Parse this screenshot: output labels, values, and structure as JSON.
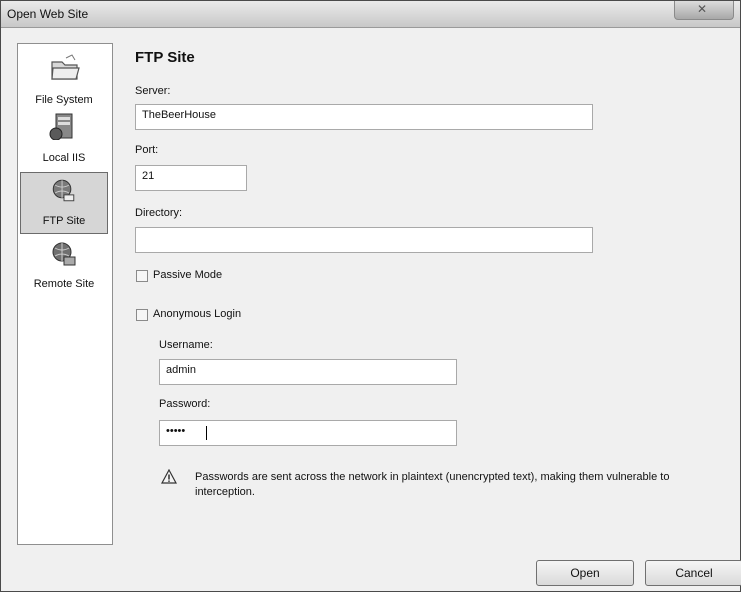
{
  "window": {
    "title": "Open Web Site"
  },
  "sidebar": {
    "items": [
      {
        "label": "File System",
        "icon": "folder-icon",
        "selected": false
      },
      {
        "label": "Local IIS",
        "icon": "server-icon",
        "selected": false
      },
      {
        "label": "FTP Site",
        "icon": "globe-icon",
        "selected": true
      },
      {
        "label": "Remote Site",
        "icon": "globe-network-icon",
        "selected": false
      }
    ]
  },
  "main": {
    "heading": "FTP Site",
    "server": {
      "label": "Server:",
      "value": "TheBeerHouse"
    },
    "port": {
      "label": "Port:",
      "value": "21"
    },
    "directory": {
      "label": "Directory:",
      "value": ""
    },
    "passive": {
      "label": "Passive Mode",
      "checked": false
    },
    "anonymous": {
      "label": "Anonymous Login",
      "checked": false
    },
    "username": {
      "label": "Username:",
      "value": "admin"
    },
    "password": {
      "label": "Password:",
      "value": "•••••"
    },
    "warning": "Passwords are sent across the network in plaintext (unencrypted text), making them vulnerable to interception."
  },
  "buttons": {
    "open": "Open",
    "cancel": "Cancel"
  }
}
